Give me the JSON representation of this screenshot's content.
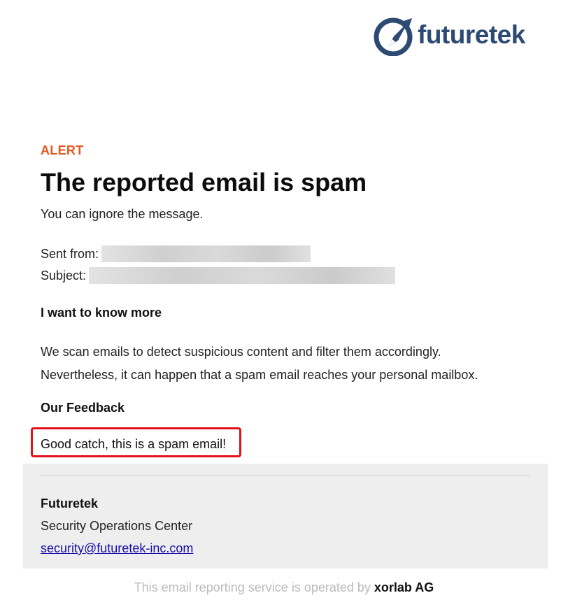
{
  "header": {
    "logo_text": "futuretek",
    "logo_icon": "arrow-circle-icon",
    "brand_color": "#2d4a73"
  },
  "alert": {
    "label": "ALERT",
    "label_color": "#e05a22",
    "headline": "The reported email is spam",
    "subline": "You can ignore the message."
  },
  "meta": {
    "sent_from_label": "Sent from:",
    "subject_label": "Subject:"
  },
  "info": {
    "heading": "I want to know more",
    "line1": "We scan emails to detect suspicious content and filter them accordingly.",
    "line2": "Nevertheless, it can happen that a spam email reaches your personal mailbox."
  },
  "feedback": {
    "heading": "Our Feedback",
    "text": "Good catch, this is a spam email!",
    "highlight_color": "#e0121b"
  },
  "footer": {
    "org": "Futuretek",
    "dept": "Security Operations Center",
    "email": "security@futuretek-inc.com",
    "operated_prefix": "This email reporting service is operated by",
    "operated_brand": "xorlab AG"
  }
}
